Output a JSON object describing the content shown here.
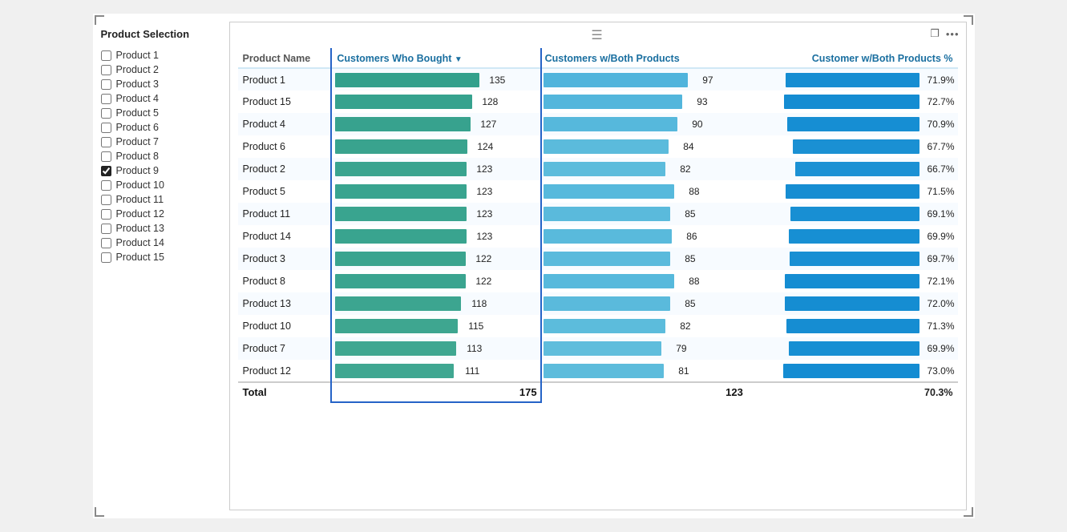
{
  "sidebar": {
    "title": "Product Selection",
    "items": [
      {
        "label": "Product 1",
        "checked": false
      },
      {
        "label": "Product 2",
        "checked": false
      },
      {
        "label": "Product 3",
        "checked": false
      },
      {
        "label": "Product 4",
        "checked": false
      },
      {
        "label": "Product 5",
        "checked": false
      },
      {
        "label": "Product 6",
        "checked": false
      },
      {
        "label": "Product 7",
        "checked": false
      },
      {
        "label": "Product 8",
        "checked": false
      },
      {
        "label": "Product 9",
        "checked": true
      },
      {
        "label": "Product 10",
        "checked": false
      },
      {
        "label": "Product 11",
        "checked": false
      },
      {
        "label": "Product 12",
        "checked": false
      },
      {
        "label": "Product 13",
        "checked": false
      },
      {
        "label": "Product 14",
        "checked": false
      },
      {
        "label": "Product 15",
        "checked": false
      }
    ]
  },
  "panel": {
    "drag_handle": "≡",
    "expand_icon": "⤢",
    "more_icon": "···"
  },
  "table": {
    "columns": [
      {
        "key": "name",
        "label": "Product Name"
      },
      {
        "key": "bought",
        "label": "Customers Who Bought",
        "sorted": true,
        "sort_dir": "desc"
      },
      {
        "key": "both",
        "label": "Customers w/Both Products"
      },
      {
        "key": "pct",
        "label": "Customer w/Both Products %"
      }
    ],
    "rows": [
      {
        "name": "Product 1",
        "bought": 135,
        "both": 97,
        "pct": "71.9%"
      },
      {
        "name": "Product 15",
        "bought": 128,
        "both": 93,
        "pct": "72.7%"
      },
      {
        "name": "Product 4",
        "bought": 127,
        "both": 90,
        "pct": "70.9%"
      },
      {
        "name": "Product 6",
        "bought": 124,
        "both": 84,
        "pct": "67.7%"
      },
      {
        "name": "Product 2",
        "bought": 123,
        "both": 82,
        "pct": "66.7%"
      },
      {
        "name": "Product 5",
        "bought": 123,
        "both": 88,
        "pct": "71.5%"
      },
      {
        "name": "Product 11",
        "bought": 123,
        "both": 85,
        "pct": "69.1%"
      },
      {
        "name": "Product 14",
        "bought": 123,
        "both": 86,
        "pct": "69.9%"
      },
      {
        "name": "Product 3",
        "bought": 122,
        "both": 85,
        "pct": "69.7%"
      },
      {
        "name": "Product 8",
        "bought": 122,
        "both": 88,
        "pct": "72.1%"
      },
      {
        "name": "Product 13",
        "bought": 118,
        "both": 85,
        "pct": "72.0%"
      },
      {
        "name": "Product 10",
        "bought": 115,
        "both": 82,
        "pct": "71.3%"
      },
      {
        "name": "Product 7",
        "bought": 113,
        "both": 79,
        "pct": "69.9%"
      },
      {
        "name": "Product 12",
        "bought": 111,
        "both": 81,
        "pct": "73.0%"
      }
    ],
    "total": {
      "label": "Total",
      "bought": 175,
      "both": 123,
      "pct": "70.3%"
    },
    "max_bought": 135,
    "max_both": 97,
    "max_pct": 73.0
  }
}
